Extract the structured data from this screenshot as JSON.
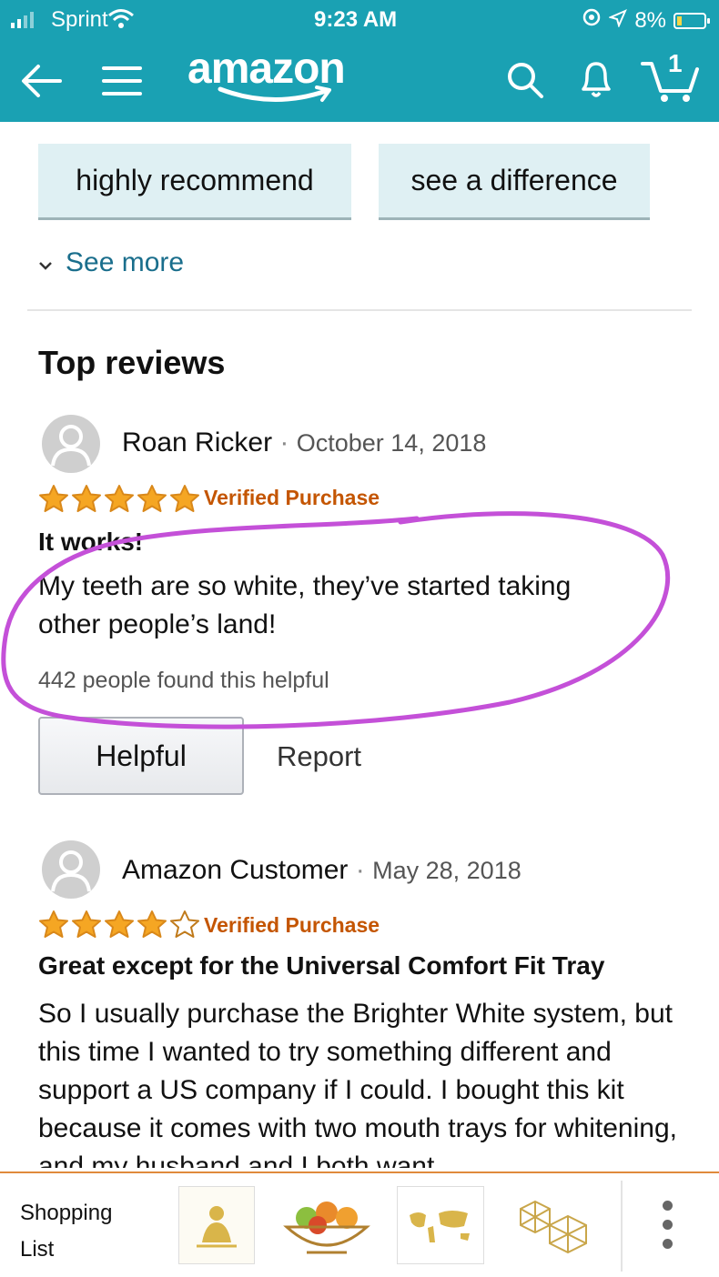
{
  "status_bar": {
    "carrier": "Sprint",
    "time": "9:23 AM",
    "battery_percent": "8%",
    "battery_level": 0.08
  },
  "nav": {
    "logo_text": "amazon",
    "cart_count": "1",
    "colors": {
      "bar": "#1aa1b3",
      "smile": "#ffffff"
    }
  },
  "chips": [
    {
      "label": "highly recommend"
    },
    {
      "label": "see a difference"
    }
  ],
  "see_more": "See more",
  "top_reviews_title": "Top reviews",
  "reviews": [
    {
      "author": "Roan Ricker",
      "separator": "·",
      "date": "October 14, 2018",
      "rating": 5,
      "badge": "Verified Purchase",
      "title": "It works!",
      "body": "My teeth are so white, they’ve started taking other people’s land!",
      "helpful_text": "442 people found this helpful",
      "helpful_button": "Helpful",
      "report_link": "Report"
    },
    {
      "author": "Amazon Customer",
      "separator": "·",
      "date": "May 28, 2018",
      "rating": 4,
      "badge": "Verified Purchase",
      "title": "Great except for the Universal Comfort Fit Tray",
      "body": "So I usually purchase the Brighter White system, but this time I wanted to try something different and support a US company if I could. I bought this kit because it comes with two mouth trays for whitening, and my husband and I both want"
    }
  ],
  "bottom_bar": {
    "shopping_list_label": "Shopping List",
    "thumbnails": [
      "buddha-print-thumbnail",
      "fruit-bowl-thumbnail",
      "world-map-thumbnail",
      "geometric-planters-thumbnail"
    ]
  },
  "annotation": {
    "color": "#c450d8"
  }
}
